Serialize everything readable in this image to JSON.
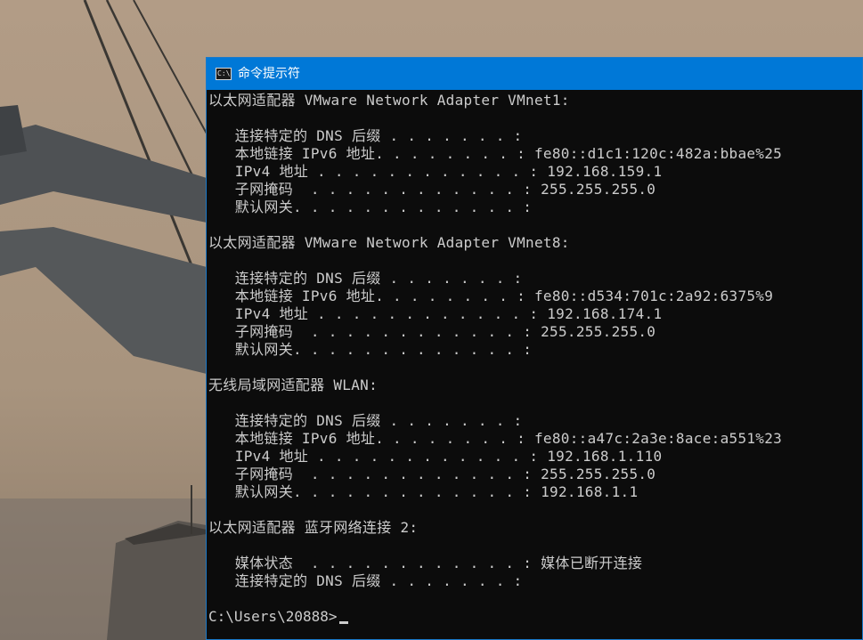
{
  "window": {
    "title": "命令提示符",
    "icon_text": "C:\\",
    "accent_color": "#0078d7",
    "console_background": "#0c0c0c",
    "console_foreground": "#cccccc"
  },
  "console_lines": [
    "以太网适配器 VMware Network Adapter VMnet1:",
    "",
    "   连接特定的 DNS 后缀 . . . . . . . :",
    "   本地链接 IPv6 地址. . . . . . . . : fe80::d1c1:120c:482a:bbae%25",
    "   IPv4 地址 . . . . . . . . . . . . : 192.168.159.1",
    "   子网掩码  . . . . . . . . . . . . : 255.255.255.0",
    "   默认网关. . . . . . . . . . . . . :",
    "",
    "以太网适配器 VMware Network Adapter VMnet8:",
    "",
    "   连接特定的 DNS 后缀 . . . . . . . :",
    "   本地链接 IPv6 地址. . . . . . . . : fe80::d534:701c:2a92:6375%9",
    "   IPv4 地址 . . . . . . . . . . . . : 192.168.174.1",
    "   子网掩码  . . . . . . . . . . . . : 255.255.255.0",
    "   默认网关. . . . . . . . . . . . . :",
    "",
    "无线局域网适配器 WLAN:",
    "",
    "   连接特定的 DNS 后缀 . . . . . . . :",
    "   本地链接 IPv6 地址. . . . . . . . : fe80::a47c:2a3e:8ace:a551%23",
    "   IPv4 地址 . . . . . . . . . . . . : 192.168.1.110",
    "   子网掩码  . . . . . . . . . . . . : 255.255.255.0",
    "   默认网关. . . . . . . . . . . . . : 192.168.1.1",
    "",
    "以太网适配器 蓝牙网络连接 2:",
    "",
    "   媒体状态  . . . . . . . . . . . . : 媒体已断开连接",
    "   连接特定的 DNS 后缀 . . . . . . . :",
    ""
  ],
  "prompt": "C:\\Users\\20888>"
}
